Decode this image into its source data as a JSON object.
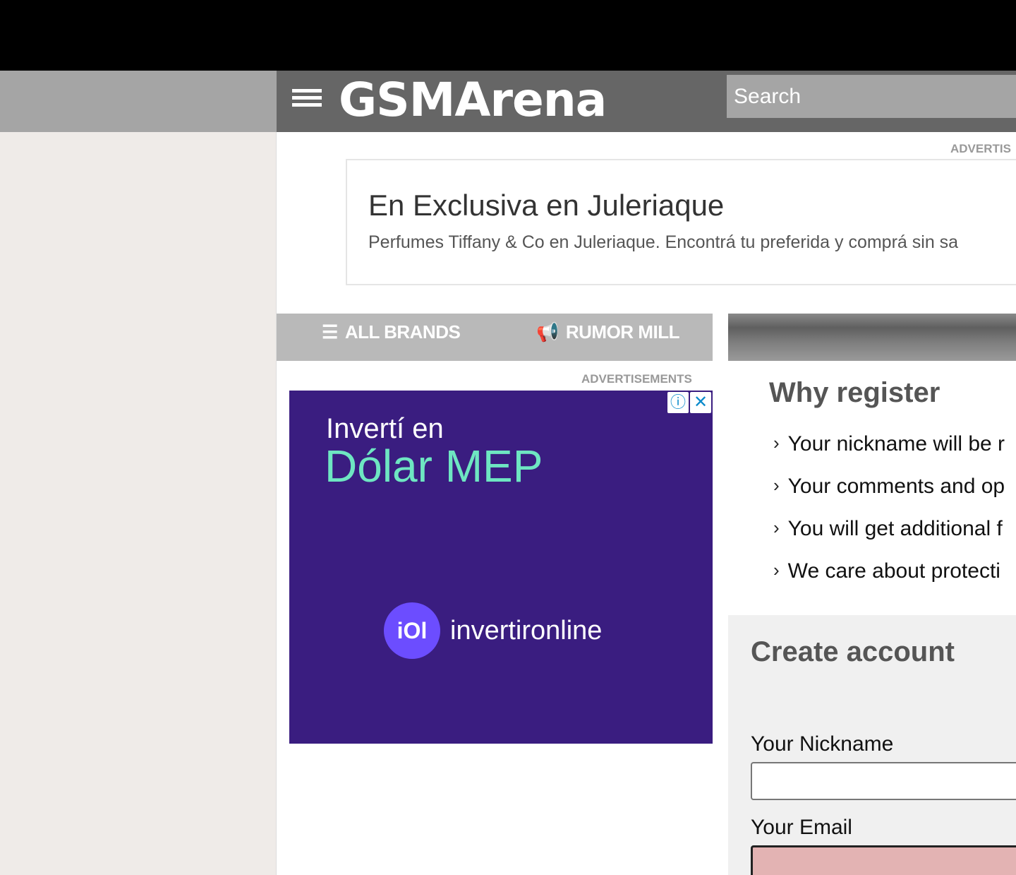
{
  "header": {
    "logo_text": "GSMArena",
    "search_placeholder": "Search"
  },
  "ad_top": {
    "label": "ADVERTIS",
    "title": "En Exclusiva en Juleriaque",
    "description": "Perfumes Tiffany & Co en Juleriaque. Encontrá tu preferida y comprá sin sa"
  },
  "quicknav": {
    "all_brands": "ALL BRANDS",
    "rumor_mill": "RUMOR MILL"
  },
  "ad_side": {
    "label": "ADVERTISEMENTS",
    "line1": "Invertí en",
    "line2": "Dólar MEP",
    "logo_text": "iOl",
    "brand_name": "invertironline"
  },
  "why_register": {
    "title": "Why register",
    "items": [
      "Your nickname will be r",
      "Your comments and op",
      "You will get additional f",
      "We care about protecti"
    ]
  },
  "create_account": {
    "title": "Create account",
    "nickname_label": "Your Nickname",
    "email_label": "Your Email",
    "nickname_value": "",
    "email_value": ""
  },
  "colors": {
    "header_bg": "#666666",
    "ad_purple": "#3a1d80",
    "ad_accent": "#6ee6c2",
    "email_error_bg": "#e3b3b3"
  }
}
